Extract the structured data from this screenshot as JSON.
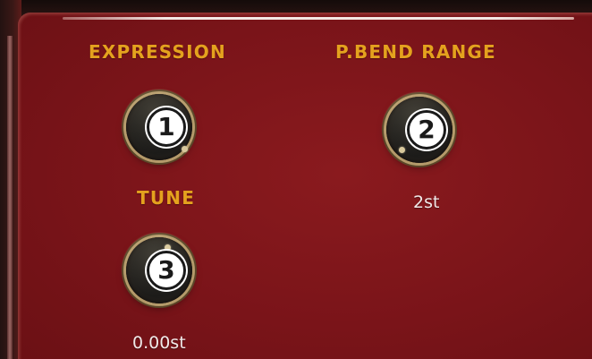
{
  "controls": [
    {
      "id": "expression",
      "label": "EXPRESSION",
      "value": "",
      "badge": "1"
    },
    {
      "id": "pbend",
      "label": "P.BEND RANGE",
      "value": "2st",
      "badge": "2"
    },
    {
      "id": "tune",
      "label": "TUNE",
      "value": "0.00st",
      "badge": "3"
    }
  ],
  "colors": {
    "panel": "#7a1419",
    "label": "#e4a21e",
    "value": "#f1e9e8",
    "knob": "#1c1b19",
    "knob_ring": "#b49a6a"
  }
}
